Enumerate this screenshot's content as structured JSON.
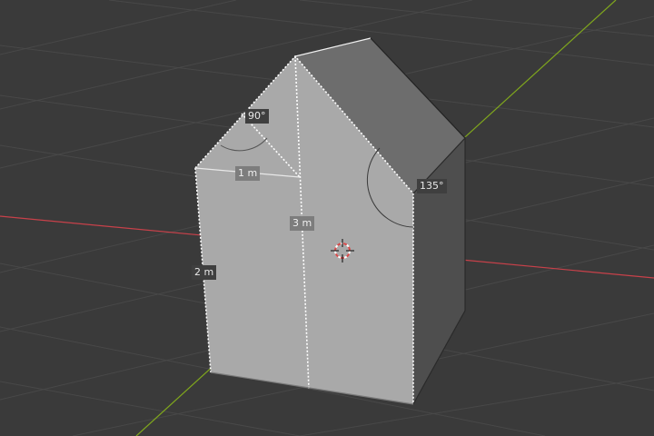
{
  "viewport": {
    "editor": "3D Viewport",
    "background_color": "#3a3a3a",
    "grid_color": "#4a4a4a",
    "x_axis_color": "#c8414a",
    "y_axis_color": "#7fa61d"
  },
  "mesh": {
    "front_face_color": "#a9a9a9",
    "side_face_color": "#4e4e4e",
    "roof_face_color": "#6d6d6d"
  },
  "measurements": {
    "angle_roof_peak": "90°",
    "angle_side": "135°",
    "length_width": "1 m",
    "length_height_center": "3 m",
    "length_height_left": "2 m"
  },
  "cursor": {
    "icon": "3d-cursor-icon",
    "colors": [
      "#d84a4a",
      "#ffffff"
    ]
  }
}
